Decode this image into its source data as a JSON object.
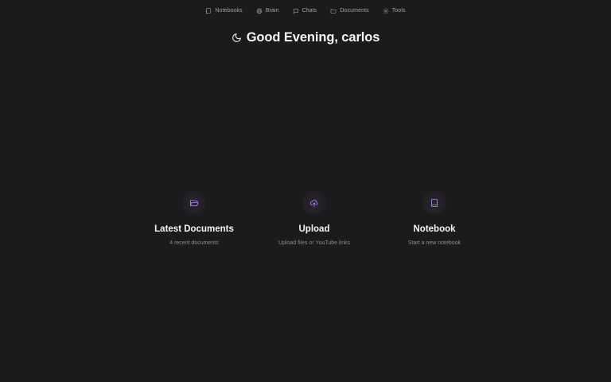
{
  "nav": {
    "items": [
      {
        "label": "Notebooks",
        "icon": "notebook-icon"
      },
      {
        "label": "Brain",
        "icon": "brain-icon"
      },
      {
        "label": "Chats",
        "icon": "chat-icon"
      },
      {
        "label": "Documents",
        "icon": "folder-icon"
      },
      {
        "label": "Tools",
        "icon": "gear-icon"
      }
    ]
  },
  "greeting": {
    "text": "Good Evening, carlos",
    "icon": "moon-icon"
  },
  "cards": [
    {
      "title": "Latest Documents",
      "subtitle": "4 recent documents",
      "icon": "folder-open-icon"
    },
    {
      "title": "Upload",
      "subtitle": "Upload files or YouTube links",
      "icon": "cloud-upload-icon"
    },
    {
      "title": "Notebook",
      "subtitle": "Start a new notebook",
      "icon": "notebook-icon"
    }
  ],
  "colors": {
    "background": "#1b1b1b",
    "accent": "#b583f0",
    "text": "#f5f5f5",
    "muted": "#8c8c8c"
  }
}
